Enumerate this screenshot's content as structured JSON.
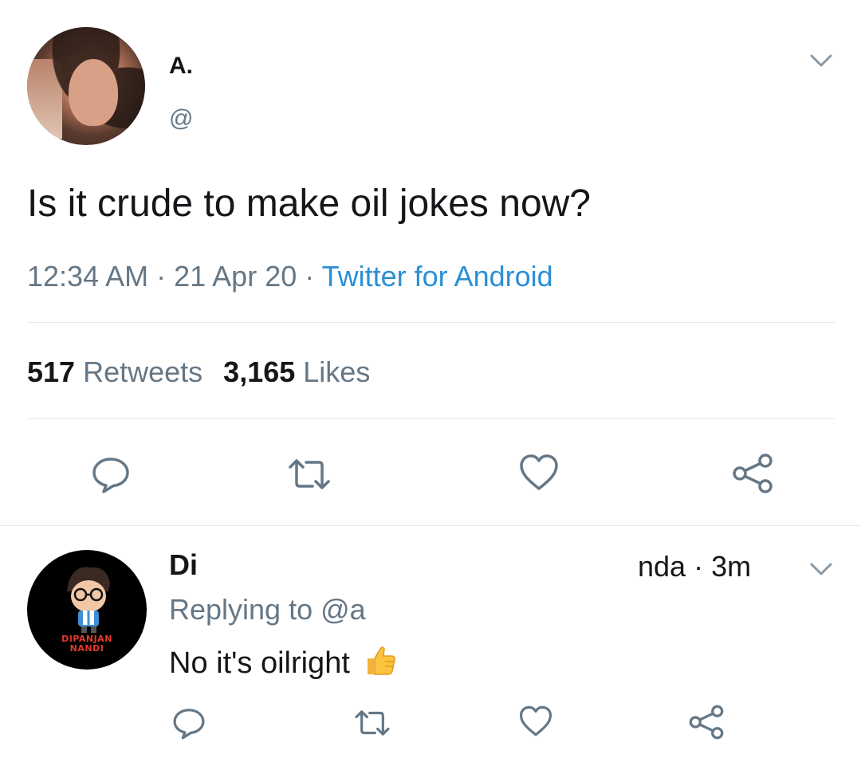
{
  "tweet": {
    "display_name": "A.",
    "handle": "@",
    "text": "Is it crude to make oil jokes now?",
    "time": "12:34 AM",
    "date": "21 Apr 20",
    "separator": " · ",
    "source": "Twitter for Android",
    "retweets_count": "517",
    "retweets_label": "Retweets",
    "likes_count": "3,165",
    "likes_label": "Likes"
  },
  "reply": {
    "display_name": "Di",
    "name_suffix": "nda",
    "time": "3m",
    "replying_prefix": "Replying to ",
    "replying_handle": "@a",
    "text": "No it's oilright",
    "avatar_text_line1": "DIPANJAN",
    "avatar_text_line2": "NANDI"
  },
  "icons": {
    "reply": "reply-icon",
    "retweet": "retweet-icon",
    "like": "heart-icon",
    "share": "share-icon",
    "more": "chevron-down-icon",
    "emoji": "thumbs-up-emoji"
  },
  "colors": {
    "text_primary": "#14171a",
    "text_secondary": "#657786",
    "link": "#2a8fd6",
    "divider": "#e1e8ed",
    "icon": "#657786"
  }
}
